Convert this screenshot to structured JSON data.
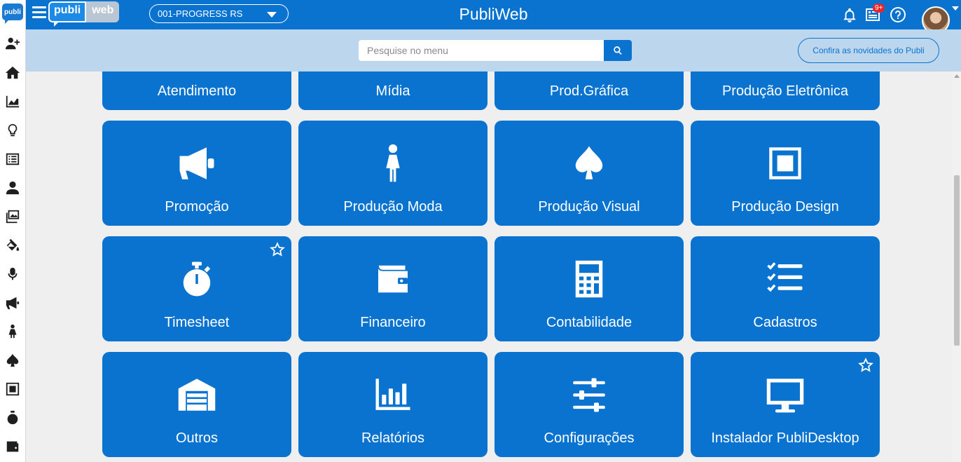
{
  "app": {
    "title": "PubliWeb",
    "logo_small": "publi",
    "brand_part1": "publi",
    "brand_part2": "web"
  },
  "header": {
    "company_selector": "001-PROGRESS RS",
    "notifications_badge": "9+",
    "icons": [
      "bell-icon",
      "news-icon",
      "help-icon",
      "avatar"
    ]
  },
  "search": {
    "placeholder": "Pesquise no menu",
    "news_button": "Confira as novidades do Publi"
  },
  "sidebar": {
    "icons": [
      "add-user-icon",
      "home-icon",
      "chart-icon",
      "lightbulb-icon",
      "list-icon",
      "person-icon",
      "images-icon",
      "paint-bucket-icon",
      "microphone-icon",
      "megaphone-icon",
      "female-icon",
      "spade-icon",
      "square-icon",
      "stopwatch-icon",
      "wallet-icon"
    ]
  },
  "cards": [
    {
      "label": "Atendimento",
      "icon": "none",
      "favorite": false
    },
    {
      "label": "Mídia",
      "icon": "none",
      "favorite": false
    },
    {
      "label": "Prod.Gráfica",
      "icon": "none",
      "favorite": false
    },
    {
      "label": "Produção Eletrônica",
      "icon": "none",
      "favorite": false
    },
    {
      "label": "Promoção",
      "icon": "megaphone-icon",
      "favorite": false
    },
    {
      "label": "Produção Moda",
      "icon": "female-icon",
      "favorite": false
    },
    {
      "label": "Produção Visual",
      "icon": "spade-icon",
      "favorite": false
    },
    {
      "label": "Produção Design",
      "icon": "square-icon",
      "favorite": false
    },
    {
      "label": "Timesheet",
      "icon": "stopwatch-icon",
      "favorite": true
    },
    {
      "label": "Financeiro",
      "icon": "wallet-icon",
      "favorite": false
    },
    {
      "label": "Contabilidade",
      "icon": "calculator-icon",
      "favorite": false
    },
    {
      "label": "Cadastros",
      "icon": "tasks-icon",
      "favorite": false
    },
    {
      "label": "Outros",
      "icon": "warehouse-icon",
      "favorite": false
    },
    {
      "label": "Relatórios",
      "icon": "bar-chart-icon",
      "favorite": false
    },
    {
      "label": "Configurações",
      "icon": "sliders-icon",
      "favorite": false
    },
    {
      "label": "Instalador PubliDesktop",
      "icon": "desktop-icon",
      "favorite": true
    }
  ],
  "colors": {
    "primary": "#0a73d0",
    "search_band": "#bcd6ee",
    "background": "#efefef"
  }
}
